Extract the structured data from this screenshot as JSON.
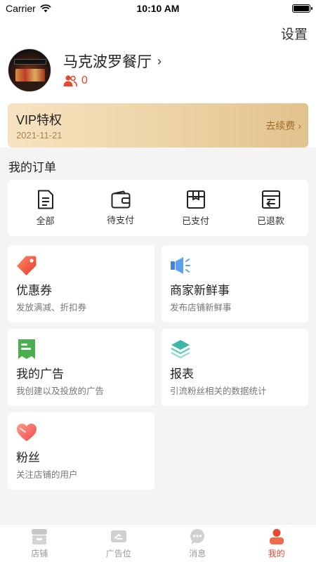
{
  "status_bar": {
    "carrier": "Carrier",
    "time": "10:10 AM"
  },
  "header": {
    "settings_label": "设置"
  },
  "profile": {
    "shop_name": "马克波罗餐厅",
    "fans_count": "0"
  },
  "vip": {
    "title": "VIP特权",
    "date": "2021-11-21",
    "renew_label": "去续费"
  },
  "orders": {
    "section_title": "我的订单",
    "items": [
      {
        "label": "全部",
        "icon": "document-icon"
      },
      {
        "label": "待支付",
        "icon": "wallet-icon"
      },
      {
        "label": "已支付",
        "icon": "box-icon"
      },
      {
        "label": "已退款",
        "icon": "refund-icon"
      }
    ]
  },
  "features": [
    {
      "title": "优惠券",
      "subtitle": "发放满减、折扣券",
      "icon": "coupon-tag-icon"
    },
    {
      "title": "商家新鲜事",
      "subtitle": "发布店铺新鲜事",
      "icon": "megaphone-icon"
    },
    {
      "title": "我的广告",
      "subtitle": "我创建以及投放的广告",
      "icon": "receipt-icon"
    },
    {
      "title": "报表",
      "subtitle": "引流粉丝相关的数据统计",
      "icon": "layers-icon"
    },
    {
      "title": "粉丝",
      "subtitle": "关注店铺的用户",
      "icon": "heart-icon"
    }
  ],
  "tabbar": {
    "items": [
      {
        "label": "店铺",
        "icon": "shop-icon"
      },
      {
        "label": "广告位",
        "icon": "ad-icon"
      },
      {
        "label": "消息",
        "icon": "message-icon"
      },
      {
        "label": "我的",
        "icon": "user-icon"
      }
    ],
    "active_index": 3
  },
  "colors": {
    "accent": "#e6472e",
    "vip_gold": "#a06b2a",
    "background": "#f4f4f4"
  }
}
